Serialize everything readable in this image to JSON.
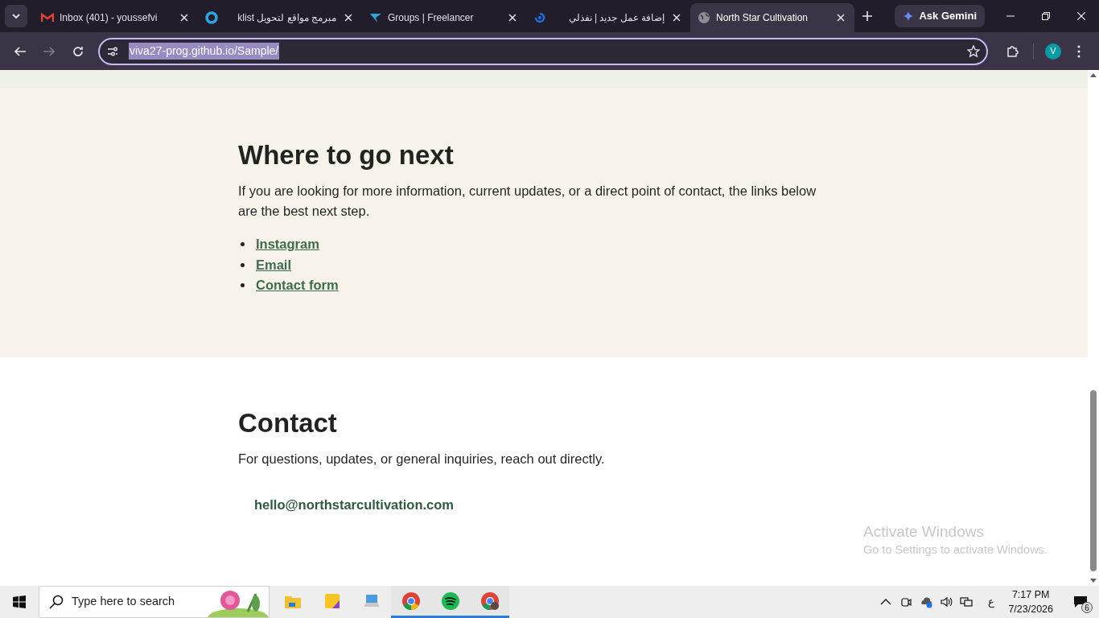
{
  "browser": {
    "tabs": [
      {
        "title": "Inbox (401) - youssefvi",
        "kind": "mail",
        "selected": false
      },
      {
        "title": "مبرمج مواقع لتحويل klist",
        "kind": "ring",
        "selected": false
      },
      {
        "title": "Groups | Freelancer",
        "kind": "bird",
        "selected": false
      },
      {
        "title": "إضافة عمل جديد | نفذلي",
        "kind": "swirl",
        "selected": false
      },
      {
        "title": "North Star Cultivation",
        "kind": "globe",
        "selected": true
      }
    ],
    "gemini": "Ask Gemini",
    "url": "viva27-prog.github.io/Sample/",
    "profile": "V"
  },
  "page": {
    "sections": [
      {
        "heading": "Where to go next",
        "text": "If you are looking for more information, current updates, or a direct point of contact, the links below are the best next step.",
        "links": [
          "Instagram",
          "Email",
          "Contact form"
        ],
        "tinted": true
      },
      {
        "heading": "Contact",
        "text": "For questions, updates, or general inquiries, reach out directly.",
        "email": "hello@northstarcultivation.com",
        "tinted": false
      }
    ]
  },
  "activation": {
    "title": "Activate Windows",
    "text": "Go to Settings to activate Windows."
  },
  "taskbar": {
    "search_placeholder": "Type here to search",
    "apps": [
      {
        "kind": "folder",
        "active": false
      },
      {
        "kind": "notes",
        "active": false
      },
      {
        "kind": "laptop",
        "active": false
      },
      {
        "kind": "chrome",
        "active": true
      },
      {
        "kind": "spotify",
        "active": true
      },
      {
        "kind": "chrome-profile",
        "active": true
      }
    ],
    "language": "ع",
    "time": "7:17 PM",
    "date": "7/23/2026",
    "notifications": "6"
  }
}
